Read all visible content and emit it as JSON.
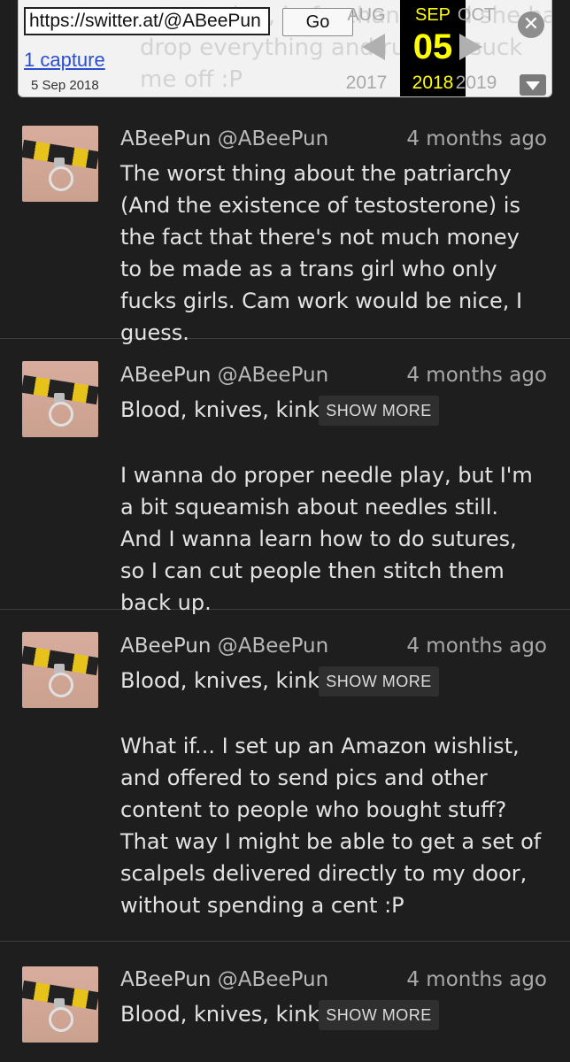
{
  "wayback": {
    "url_value": "https://switter.at/@ABeePun",
    "go_label": "Go",
    "captures_label": "1 capture",
    "capture_date": "5 Sep 2018",
    "prev_month": "AUG",
    "prev_year": "2017",
    "current_month": "SEP",
    "current_day": "05",
    "current_year": "2018",
    "next_month": "OCT",
    "next_year": "2019",
    "close_icon_glyph": "✕",
    "behind_text_1": "no warning, beforehand, and she had to",
    "behind_text_2": "drop everything and rush to suck",
    "behind_text_3": "me off :P"
  },
  "posts": [
    {
      "display_name": "ABeePun",
      "handle": "@ABeePun",
      "time": "4 months ago",
      "tags": "",
      "body": "The worst thing about the patriarchy (And the existence of testosterone) is the fact that there's not much money to be made as a trans girl who only fucks girls. Cam work would be nice, I guess."
    },
    {
      "display_name": "ABeePun",
      "handle": "@ABeePun",
      "time": "4 months ago",
      "tags": "Blood, knives, kink",
      "show_more": "SHOW MORE",
      "body": "I wanna do proper needle play, but I'm a bit squeamish about needles still. And I wanna learn how to do sutures, so I can cut people then stitch them back up."
    },
    {
      "display_name": "ABeePun",
      "handle": "@ABeePun",
      "time": "4 months ago",
      "tags": "Blood, knives, kink",
      "show_more": "SHOW MORE",
      "body": "What if... I set up an Amazon wishlist, and offered to send pics and other content to people who bought stuff? That way I might be able to get a set of scalpels delivered directly to my door, without spending a cent :P"
    },
    {
      "display_name": "ABeePun",
      "handle": "@ABeePun",
      "time": "4 months ago",
      "tags": "Blood, knives, kink",
      "show_more": "SHOW MORE",
      "body": ""
    }
  ]
}
